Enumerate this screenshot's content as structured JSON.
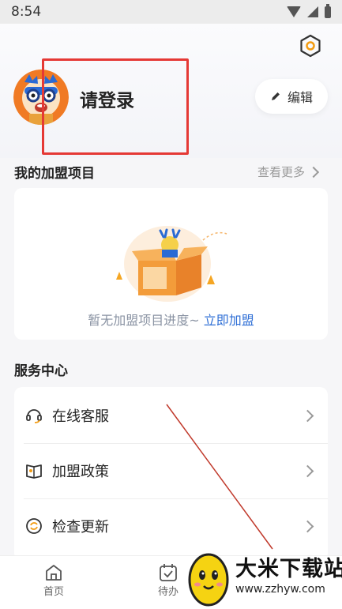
{
  "status_bar": {
    "time": "8:54"
  },
  "profile": {
    "login_prompt": "请登录",
    "edit_label": "编辑"
  },
  "projects": {
    "title": "我的加盟项目",
    "more_label": "查看更多",
    "empty_text": "暂无加盟项目进度~",
    "join_link": "立即加盟"
  },
  "service": {
    "title": "服务中心",
    "items": [
      {
        "label": "在线客服",
        "icon": "headset-icon"
      },
      {
        "label": "加盟政策",
        "icon": "book-icon"
      },
      {
        "label": "检查更新",
        "icon": "refresh-icon"
      }
    ]
  },
  "bottom_nav": [
    {
      "label": "首页",
      "icon": "home-icon"
    },
    {
      "label": "待办",
      "icon": "calendar-check-icon"
    }
  ],
  "watermark": {
    "text": "大米下载站",
    "url": "www.zzhyw.com"
  },
  "colors": {
    "accent": "#2f6fd6",
    "settings": "#f39c12",
    "annotation": "#e53935"
  }
}
